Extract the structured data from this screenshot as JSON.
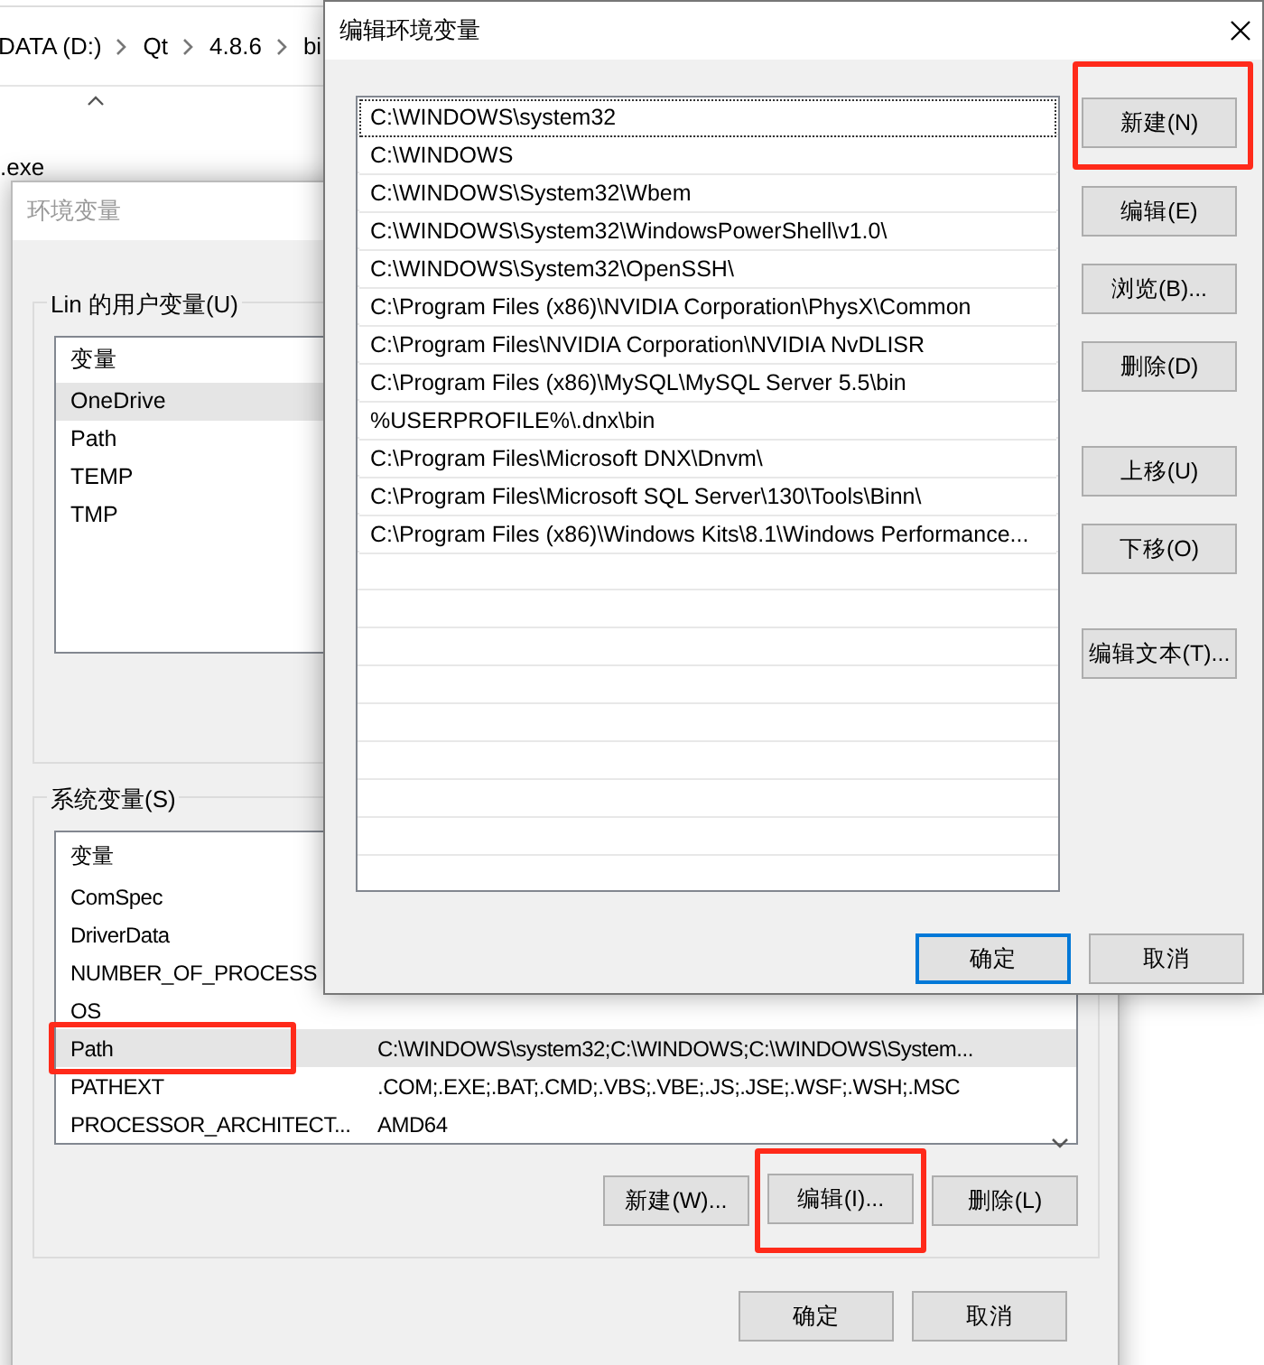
{
  "explorer": {
    "breadcrumb": [
      "DATA (D:)",
      "Qt",
      "4.8.6",
      "bi"
    ],
    "file": ".exe"
  },
  "env_window": {
    "title": "环境变量",
    "active": false,
    "user_vars": {
      "label": "Lin 的用户变量(U)",
      "header": "变量",
      "rows": [
        {
          "name": "OneDrive",
          "selected": true
        },
        {
          "name": "Path",
          "selected": false
        },
        {
          "name": "TEMP",
          "selected": false
        },
        {
          "name": "TMP",
          "selected": false
        }
      ]
    },
    "system_vars": {
      "label": "系统变量(S)",
      "header": "变量",
      "rows": [
        {
          "name": "ComSpec",
          "selected": false,
          "highlighted": false
        },
        {
          "name": "DriverData",
          "selected": false,
          "highlighted": false
        },
        {
          "name": "NUMBER_OF_PROCESS",
          "selected": false,
          "highlighted": false
        },
        {
          "name": "OS",
          "selected": false,
          "highlighted": false
        },
        {
          "name": "Path",
          "value": "C:\\WINDOWS\\system32;C:\\WINDOWS;C:\\WINDOWS\\System...",
          "selected": true,
          "highlighted": true
        },
        {
          "name": "PATHEXT",
          "value": ".COM;.EXE;.BAT;.CMD;.VBS;.VBE;.JS;.JSE;.WSF;.WSH;.MSC",
          "selected": false,
          "highlighted": false
        },
        {
          "name": "PROCESSOR_ARCHITECT...",
          "value": "AMD64",
          "selected": false,
          "highlighted": false
        }
      ]
    },
    "buttons": [
      {
        "label": "新建(W)...",
        "highlighted": false
      },
      {
        "label": "编辑(I)...",
        "highlighted": true
      },
      {
        "label": "删除(L)",
        "highlighted": false
      }
    ],
    "dialog_buttons": [
      {
        "label": "确定",
        "default": false
      },
      {
        "label": "取消",
        "default": false
      }
    ]
  },
  "edit_dialog": {
    "title": "编辑环境变量",
    "entries": [
      {
        "path": "C:\\WINDOWS\\system32",
        "focused": true
      },
      {
        "path": "C:\\WINDOWS",
        "focused": false
      },
      {
        "path": "C:\\WINDOWS\\System32\\Wbem",
        "focused": false
      },
      {
        "path": "C:\\WINDOWS\\System32\\WindowsPowerShell\\v1.0\\",
        "focused": false
      },
      {
        "path": "C:\\WINDOWS\\System32\\OpenSSH\\",
        "focused": false
      },
      {
        "path": "C:\\Program Files (x86)\\NVIDIA Corporation\\PhysX\\Common",
        "focused": false
      },
      {
        "path": "C:\\Program Files\\NVIDIA Corporation\\NVIDIA NvDLISR",
        "focused": false
      },
      {
        "path": "C:\\Program Files (x86)\\MySQL\\MySQL Server 5.5\\bin",
        "focused": false
      },
      {
        "path": "%USERPROFILE%\\.dnx\\bin",
        "focused": false
      },
      {
        "path": "C:\\Program Files\\Microsoft DNX\\Dnvm\\",
        "focused": false
      },
      {
        "path": "C:\\Program Files\\Microsoft SQL Server\\130\\Tools\\Binn\\",
        "focused": false
      },
      {
        "path": "C:\\Program Files (x86)\\Windows Kits\\8.1\\Windows Performance...",
        "focused": false
      }
    ],
    "button_groups": [
      [
        {
          "label": "新建(N)",
          "highlighted": true
        },
        {
          "label": "编辑(E)",
          "highlighted": false
        },
        {
          "label": "浏览(B)...",
          "highlighted": false
        },
        {
          "label": "删除(D)",
          "highlighted": false
        }
      ],
      [
        {
          "label": "上移(U)",
          "highlighted": false
        },
        {
          "label": "下移(O)",
          "highlighted": false
        }
      ],
      [
        {
          "label": "编辑文本(T)...",
          "highlighted": false
        }
      ]
    ],
    "dialog_buttons": [
      {
        "label": "确定",
        "default": true
      },
      {
        "label": "取消",
        "default": false
      }
    ]
  }
}
